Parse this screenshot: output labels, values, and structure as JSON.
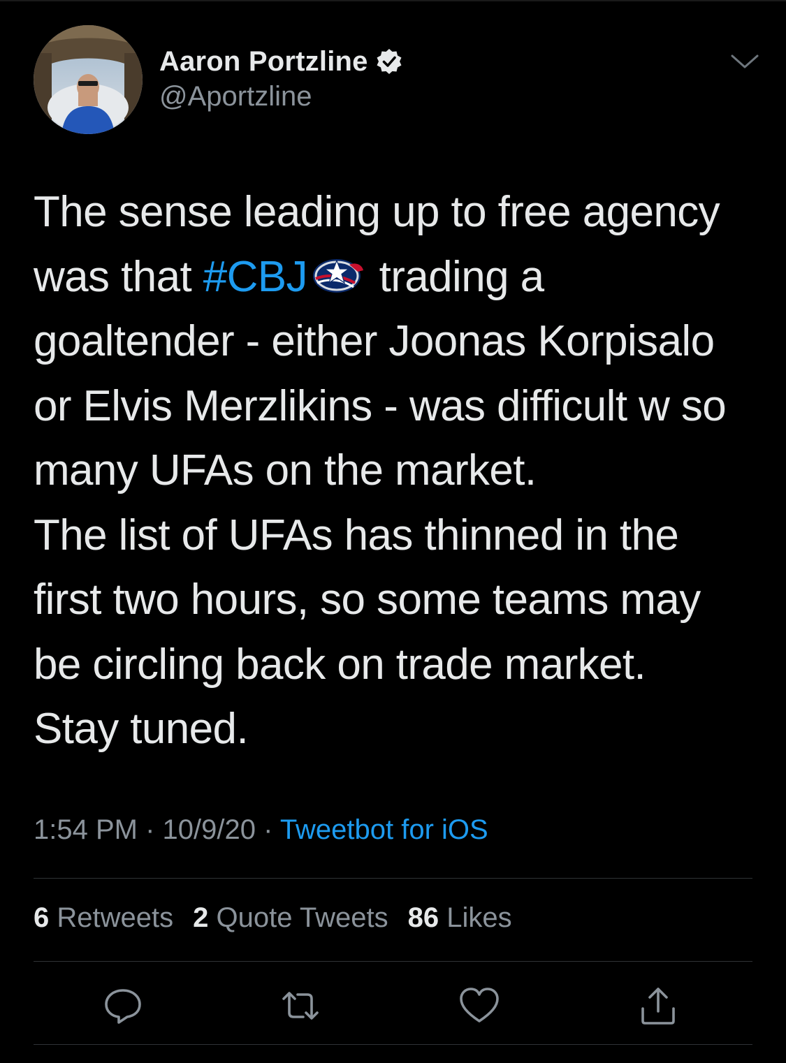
{
  "author": {
    "display_name": "Aaron Portzline",
    "handle": "@Aportzline",
    "verified": true
  },
  "tweet": {
    "lines": [
      "The sense leading up to free agency",
      "was that ",
      " trading a",
      "goaltender - either Joonas Korpisalo",
      "or Elvis Merzlikins - was difficult w so",
      "many UFAs on the market.",
      "The list of UFAs has thinned in the",
      "first two hours, so some teams may",
      "be circling back on trade market.",
      "Stay tuned."
    ],
    "hashtag": "#CBJ"
  },
  "meta": {
    "time": "1:54 PM",
    "separator": " · ",
    "date": "10/9/20",
    "source": "Tweetbot for iOS"
  },
  "stats": {
    "retweets_count": "6",
    "retweets_label": "Retweets",
    "quotes_count": "2",
    "quotes_label": "Quote Tweets",
    "likes_count": "86",
    "likes_label": "Likes"
  },
  "icons": {
    "verified": "verified-badge-icon",
    "more": "chevron-down-icon",
    "reply": "reply-icon",
    "retweet": "retweet-icon",
    "like": "heart-icon",
    "share": "share-icon",
    "team": "blue-jackets-logo-icon"
  },
  "colors": {
    "background": "#000000",
    "text": "#e7e9ea",
    "secondary": "#8b939b",
    "link": "#1d9bf0",
    "divider": "#2f3336"
  }
}
